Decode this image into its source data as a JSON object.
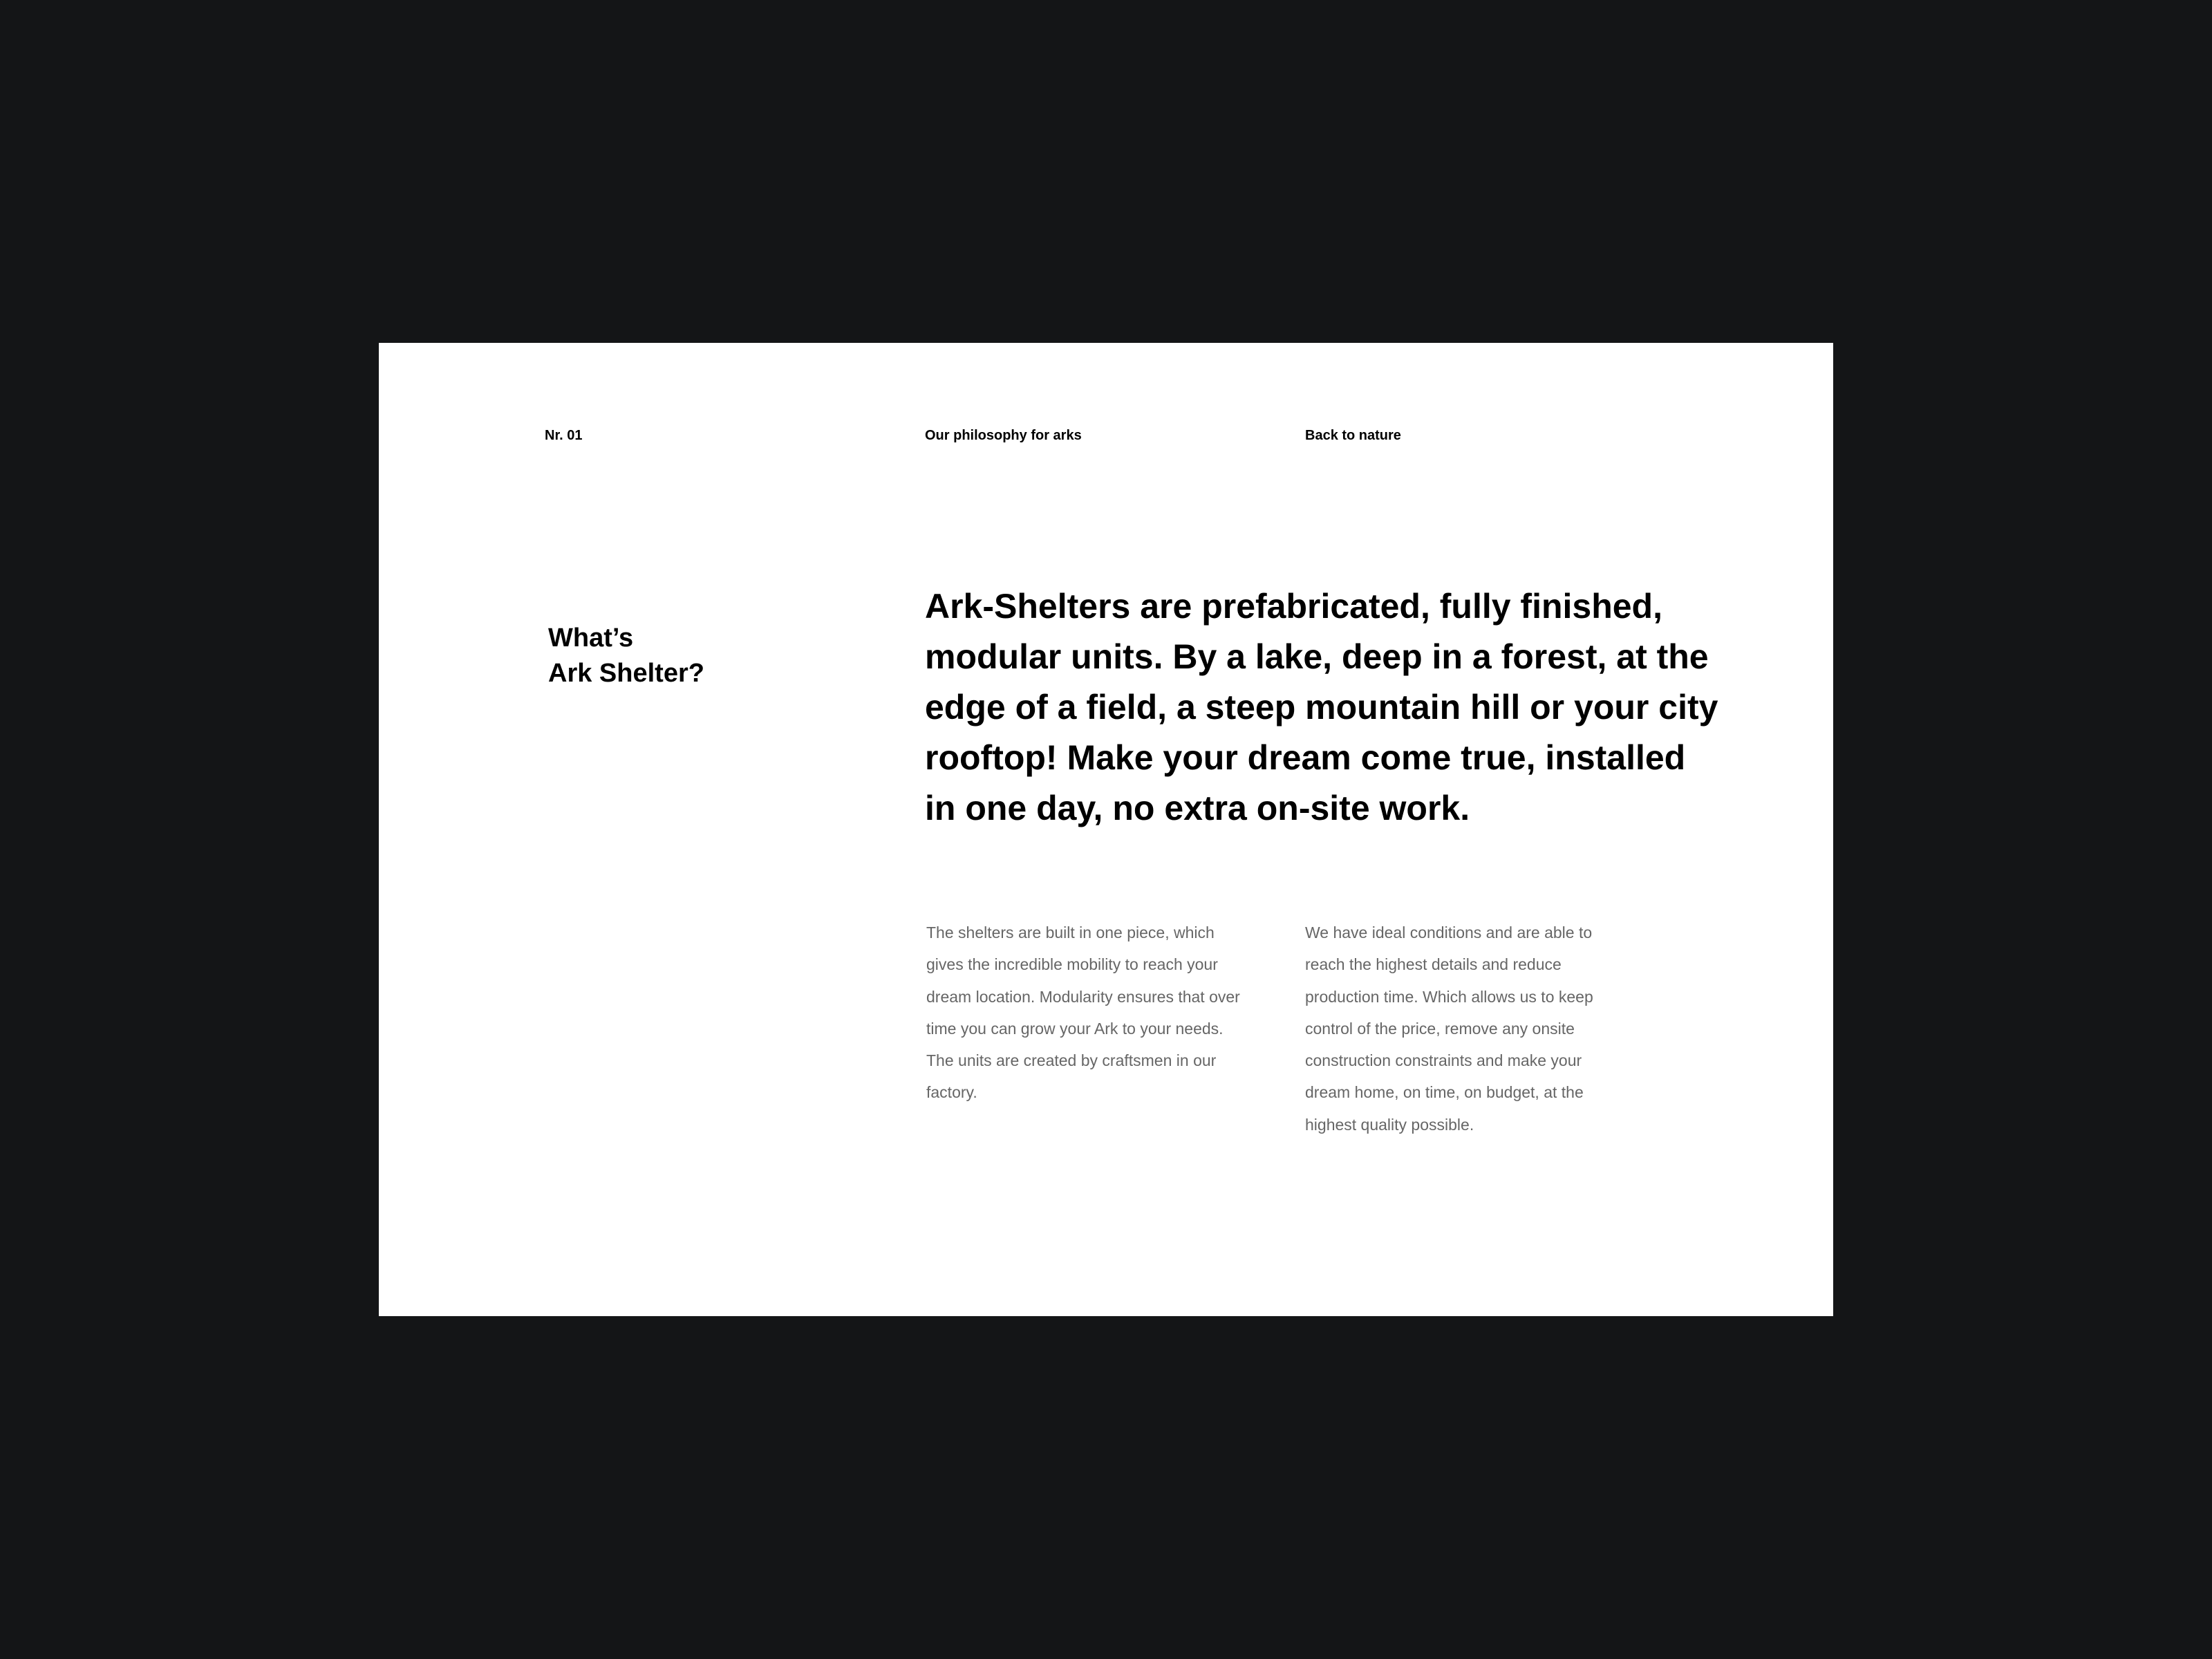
{
  "header": {
    "number": "Nr. 01",
    "section": "Our philosophy for arks",
    "subsection": "Back to nature"
  },
  "intro": {
    "title_line1": "What’s",
    "title_line2": "Ark Shelter?",
    "lead": "Ark-Shelters are prefabricated, fully finished, modular units. By a lake, deep in a forest, at the edge of a field, a steep mountain hill or your city rooftop! Make your dream come true, installed in one day, no extra on-site work."
  },
  "columns": [
    {
      "text": "The shelters are built in one piece, which gives the incredible mobility to reach your dream location. Modularity ensures that over time you can grow your Ark to your needs. The units are created by craftsmen in our factory."
    },
    {
      "text": "We have ideal conditions and are able to reach the highest details and reduce production time. Which allows us to keep control of the price, remove any onsite construction constraints and make your dream home, on time, on budget, at the highest quality possible."
    }
  ],
  "colors": {
    "background": "#141517",
    "card": "#ffffff",
    "heading": "#000000",
    "body_text": "#666666"
  }
}
